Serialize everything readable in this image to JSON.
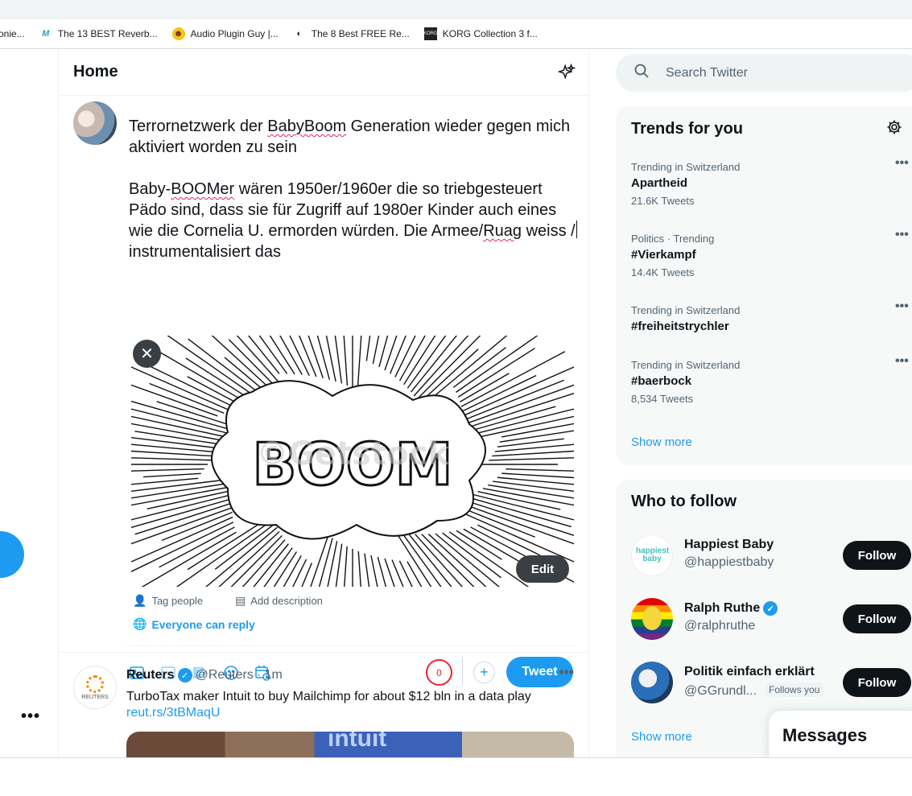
{
  "bookmarks": [
    {
      "label": "onie...",
      "icon": "bookmark-favicon"
    },
    {
      "label": "The 13 BEST Reverb...",
      "icon": "m-logo-icon"
    },
    {
      "label": "Audio Plugin Guy |...",
      "icon": "emoji-favicon"
    },
    {
      "label": "The 8 Best FREE Re...",
      "icon": "moon-favicon"
    },
    {
      "label": "KORG Collection 3 f...",
      "icon": "korg-favicon"
    }
  ],
  "home": {
    "title": "Home",
    "sparkle_icon": "sparkle-icon"
  },
  "composer": {
    "line1_pre": "Terrornetzwerk der ",
    "line1_sq": "BabyBoom",
    "line1_post": " Generation wieder gegen mich aktiviert worden zu sein",
    "para2_pre": "Baby-",
    "para2_sq": "BOOMer",
    "para2_mid": " wären 1950er/1960er die so triebgesteuert Pädo sind, dass sie für Zugriff auf 1980er Kinder auch eines wie die Cornelia U. ermorden würden. Die Armee/",
    "para2_sq2": "Ruag",
    "para2_end_a": " weiss /",
    "para2_end_b": " instrumentalisiert das",
    "media_word": "BOOM",
    "media_watermark": "©Getstock",
    "edit_label": "Edit",
    "tag_people": "Tag people",
    "add_description": "Add description",
    "reply_setting": "Everyone can reply",
    "counter": "0",
    "tweet_label": "Tweet"
  },
  "feed": {
    "author": "Reuters",
    "handle": "@Reuters",
    "time": "· 1m",
    "avatar_text": "REUTERS",
    "text": "TurboTax maker Intuit to buy Mailchimp for about $12 bln in a data play",
    "link": "reut.rs/3tBMaqU",
    "image_text": "intuit"
  },
  "search": {
    "placeholder": "Search Twitter"
  },
  "trends": {
    "title": "Trends for you",
    "items": [
      {
        "context": "Trending in Switzerland",
        "name": "Apartheid",
        "count": "21.6K Tweets"
      },
      {
        "context": "Politics · Trending",
        "name": "#Vierkampf",
        "count": "14.4K Tweets"
      },
      {
        "context": "Trending in Switzerland",
        "name": "#freiheitstrychler",
        "count": ""
      },
      {
        "context": "Trending in Switzerland",
        "name": "#baerbock",
        "count": "8,534 Tweets"
      }
    ],
    "show_more": "Show more"
  },
  "who_to_follow": {
    "title": "Who to follow",
    "items": [
      {
        "name": "Happiest Baby",
        "handle": "@happiestbaby",
        "verified": false,
        "follows_you": "",
        "avatar_text": "happiest baby"
      },
      {
        "name": "Ralph Ruthe",
        "handle": "@ralphruthe",
        "verified": true,
        "follows_you": ""
      },
      {
        "name": "Politik einfach erklärt",
        "handle": "@GGrundl...",
        "verified": false,
        "follows_you": "Follows you"
      }
    ],
    "follow_label": "Follow",
    "show_more": "Show more"
  },
  "messages": {
    "title": "Messages"
  },
  "colors": {
    "accent": "#1d9bf0",
    "text": "#0f1419",
    "muted": "#536471",
    "error": "#f4212e"
  }
}
